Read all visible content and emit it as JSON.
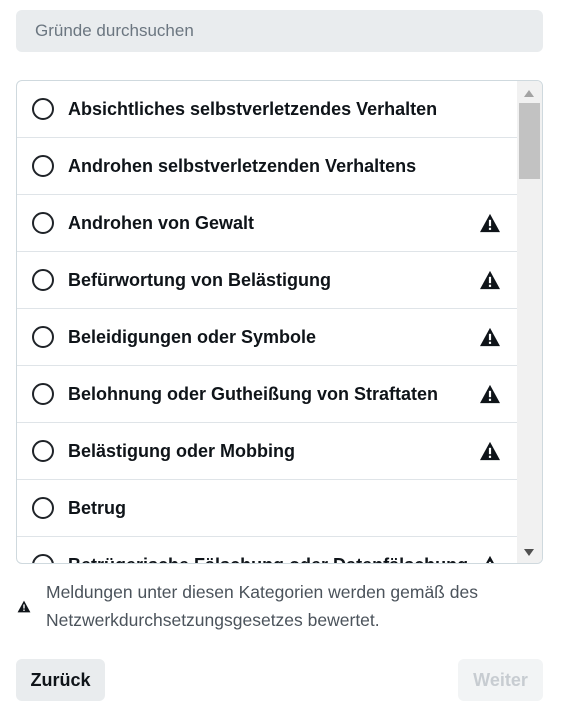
{
  "search": {
    "placeholder": "Gründe durchsuchen"
  },
  "reasons": [
    {
      "label": "Absichtliches selbstverletzendes Verhalten",
      "warning": false
    },
    {
      "label": "Androhen selbstverletzenden Verhaltens",
      "warning": false
    },
    {
      "label": "Androhen von Gewalt",
      "warning": true
    },
    {
      "label": "Befürwortung von Belästigung",
      "warning": true
    },
    {
      "label": "Beleidigungen oder Symbole",
      "warning": true
    },
    {
      "label": "Belohnung oder Gutheißung von Straftaten",
      "warning": true
    },
    {
      "label": "Belästigung oder Mobbing",
      "warning": true
    },
    {
      "label": "Betrug",
      "warning": false
    },
    {
      "label": "Betrügerische Fälschung oder Datenfälschung",
      "warning": true
    }
  ],
  "note": {
    "text": "Meldungen unter diesen Kategorien werden gemäß des Netzwerkdurchsetzungsgesetzes bewertet."
  },
  "buttons": {
    "back_label": "Zurück",
    "next_label": "Weiter"
  },
  "icons": {
    "warning": "warning-triangle-icon",
    "radio": "radio-unchecked-icon"
  }
}
